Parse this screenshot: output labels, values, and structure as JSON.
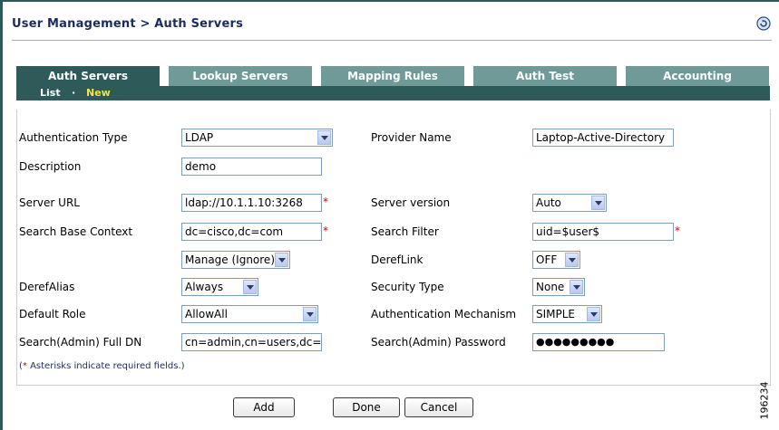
{
  "header": {
    "breadcrumb": "User Management > Auth Servers",
    "help_icon": "refresh-help-icon"
  },
  "tabs": [
    {
      "label": "Auth Servers",
      "active": true
    },
    {
      "label": "Lookup Servers",
      "active": false
    },
    {
      "label": "Mapping Rules",
      "active": false
    },
    {
      "label": "Auth Test",
      "active": false
    },
    {
      "label": "Accounting",
      "active": false
    }
  ],
  "subnav": {
    "list_label": "List",
    "separator": "·",
    "new_label": "New"
  },
  "form": {
    "auth_type": {
      "label": "Authentication Type",
      "value": "LDAP"
    },
    "provider_name": {
      "label": "Provider Name",
      "value": "Laptop-Active-Directory"
    },
    "description": {
      "label": "Description",
      "value": "demo"
    },
    "server_url": {
      "label": "Server URL",
      "value": "ldap://10.1.1.10:3268"
    },
    "server_version": {
      "label": "Server version",
      "value": "Auto"
    },
    "search_base": {
      "label": "Search Base Context",
      "value": "dc=cisco,dc=com"
    },
    "search_filter": {
      "label": "Search Filter",
      "value": "uid=$user$"
    },
    "referral": {
      "value": "Manage (Ignore)"
    },
    "deref_link": {
      "label": "DerefLink",
      "value": "OFF"
    },
    "deref_alias": {
      "label": "DerefAlias",
      "value": "Always"
    },
    "security_type": {
      "label": "Security Type",
      "value": "None"
    },
    "default_role": {
      "label": "Default Role",
      "value": "AllowAll"
    },
    "auth_mechanism": {
      "label": "Authentication Mechanism",
      "value": "SIMPLE"
    },
    "admin_dn": {
      "label": "Search(Admin) Full DN",
      "value": "cn=admin,cn=users,dc=ci"
    },
    "admin_password": {
      "label": "Search(Admin) Password",
      "value": "●●●●●●●●●"
    },
    "required_star": "*",
    "note_open": "(",
    "note_star": "*",
    "note_text": " Asterisks indicate required fields.)"
  },
  "buttons": {
    "add": "Add",
    "done": "Done",
    "cancel": "Cancel"
  },
  "figure_number": "196234",
  "colors": {
    "tab_active": "#2e5b5a",
    "tab_inactive": "#6f9a98",
    "new_link": "#f2e24a",
    "title": "#1b2b5e",
    "required": "#d10000"
  }
}
